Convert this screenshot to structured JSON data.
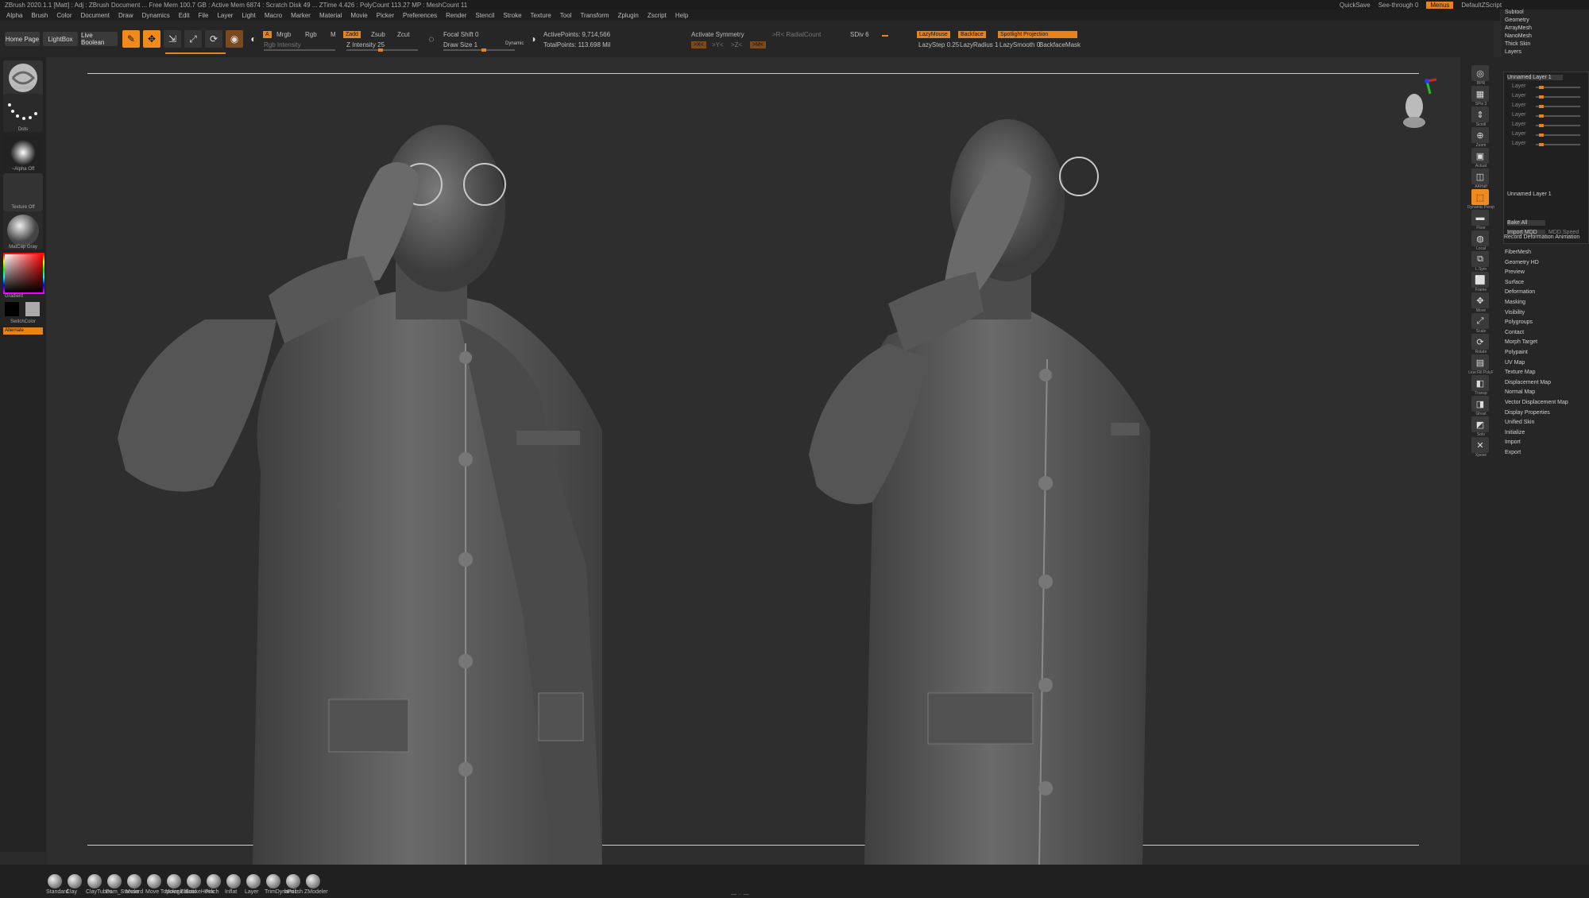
{
  "title_bar": {
    "title": "ZBrush 2020.1.1 [Matt] : Adj : ZBrush Document ... Free Mem 100.7 GB : Active Mem 6874 : Scratch Disk 49 ... ZTime 4.426 : PolyCount 113.27 MP : MeshCount 11",
    "quicksave": "QuickSave",
    "seethrough": "See-through 0",
    "menus_btn": "Menus",
    "default_zscript": "DefaultZScript"
  },
  "menubar": [
    "Alpha",
    "Brush",
    "Color",
    "Document",
    "Draw",
    "Dynamics",
    "Edit",
    "File",
    "Layer",
    "Light",
    "Macro",
    "Marker",
    "Material",
    "Movie",
    "Picker",
    "Preferences",
    "Render",
    "Stencil",
    "Stroke",
    "Texture",
    "Tool",
    "Transform",
    "Zplugin",
    "Zscript",
    "Help"
  ],
  "toolbar": {
    "home_page": "Home Page",
    "lightbox": "LightBox",
    "live_boolean": "Live Boolean",
    "btns": {
      "edit": "Edit",
      "draw": "Draw",
      "move": "Move",
      "scale": "Scale",
      "rotate": "Rotate"
    },
    "a_label": "A",
    "mrgb": "Mrgb",
    "rgb": "Rgb",
    "m_label": "M",
    "zadd": "Zadd",
    "zsub": "Zsub",
    "zcut": "Zcut",
    "rgb_intensity": "Rgb Intensity",
    "z_intensity": "Z Intensity 25",
    "focal_shift": "Focal Shift 0",
    "draw_size": "Draw Size 1",
    "dynamic": "Dynamic",
    "active_points": "ActivePoints: 9,714,566",
    "total_points": "TotalPoints: 113.698 Mil",
    "activate_symmetry": "Activate Symmetry",
    "sym_x": ">X<",
    "sym_y": ">Y<",
    "sym_z": ">Z<",
    "sym_m": ">M<",
    "sym_r": "(R)",
    "radial_symmetry": ">R< RadialCount",
    "sdiv": "SDiv 6",
    "lazy_mouse": "LazyMouse",
    "backface": "Backface",
    "spotlight": "Spotlight Projection",
    "lazy_step": "LazyStep 0.25",
    "lazy_radius": "LazyRadius 1",
    "lazy_smooth": "LazySmooth 0",
    "backface_mask": "BackfaceMask"
  },
  "left_shelf": {
    "brush": "Standard",
    "stroke": "Dots",
    "alpha": "~Alpha Off",
    "texture": "Texture Off",
    "material": "MatCap Gray",
    "gradient": "Gradient",
    "switch_color": "SwitchColor",
    "alternate": "Alternate"
  },
  "right_shelf": [
    "BPR",
    "SPix 3",
    "Scroll",
    "Zoom",
    "Actual",
    "AAHalf",
    "Dynamic Persp",
    "Floor",
    "Local",
    "L.Sym",
    "Frame",
    "Move",
    "Scale",
    "Rotate",
    "Line Fill PolyF",
    "Transp",
    "Ghost",
    "Solo",
    "Xpose"
  ],
  "panel": {
    "top_items": [
      "Subtool",
      "Geometry",
      "ArrayMesh",
      "NanoMesh",
      "Thick Skin",
      "Layers"
    ],
    "layer_name": "Unnamed Layer 1",
    "layer_rows": [
      "Layer",
      "Layer",
      "Layer",
      "Layer",
      "Layer",
      "Layer",
      "Layer"
    ],
    "layer_footer": "Unnamed Layer 1",
    "bake_all": "Bake All",
    "import_mdd": "Import MDD",
    "mdd_speed": "MDD Speed",
    "record_deformations": "Record Deformation Animation",
    "items": [
      "FiberMesh",
      "Geometry HD",
      "Preview",
      "Surface",
      "Deformation",
      "Masking",
      "Visibility",
      "Polygroups",
      "Contact",
      "Morph Target",
      "Polypaint",
      "UV Map",
      "Texture Map",
      "Displacement Map",
      "Normal Map",
      "Vector Displacement Map",
      "Display Properties",
      "Unified Skin",
      "Initialize",
      "Import",
      "Export"
    ]
  },
  "bottom_brushes": [
    "Standard",
    "Clay",
    "ClayTubes",
    "Dam_Standard",
    "Move",
    "Move Topological",
    "Move Elastic",
    "SnakeHook",
    "Pinch",
    "Inflat",
    "Layer",
    "TrimDynamic",
    "hPolish",
    "ZModeler"
  ],
  "colors": {
    "accent": "#f08a1c",
    "bg": "#2e2e2e",
    "panel": "#262626"
  }
}
